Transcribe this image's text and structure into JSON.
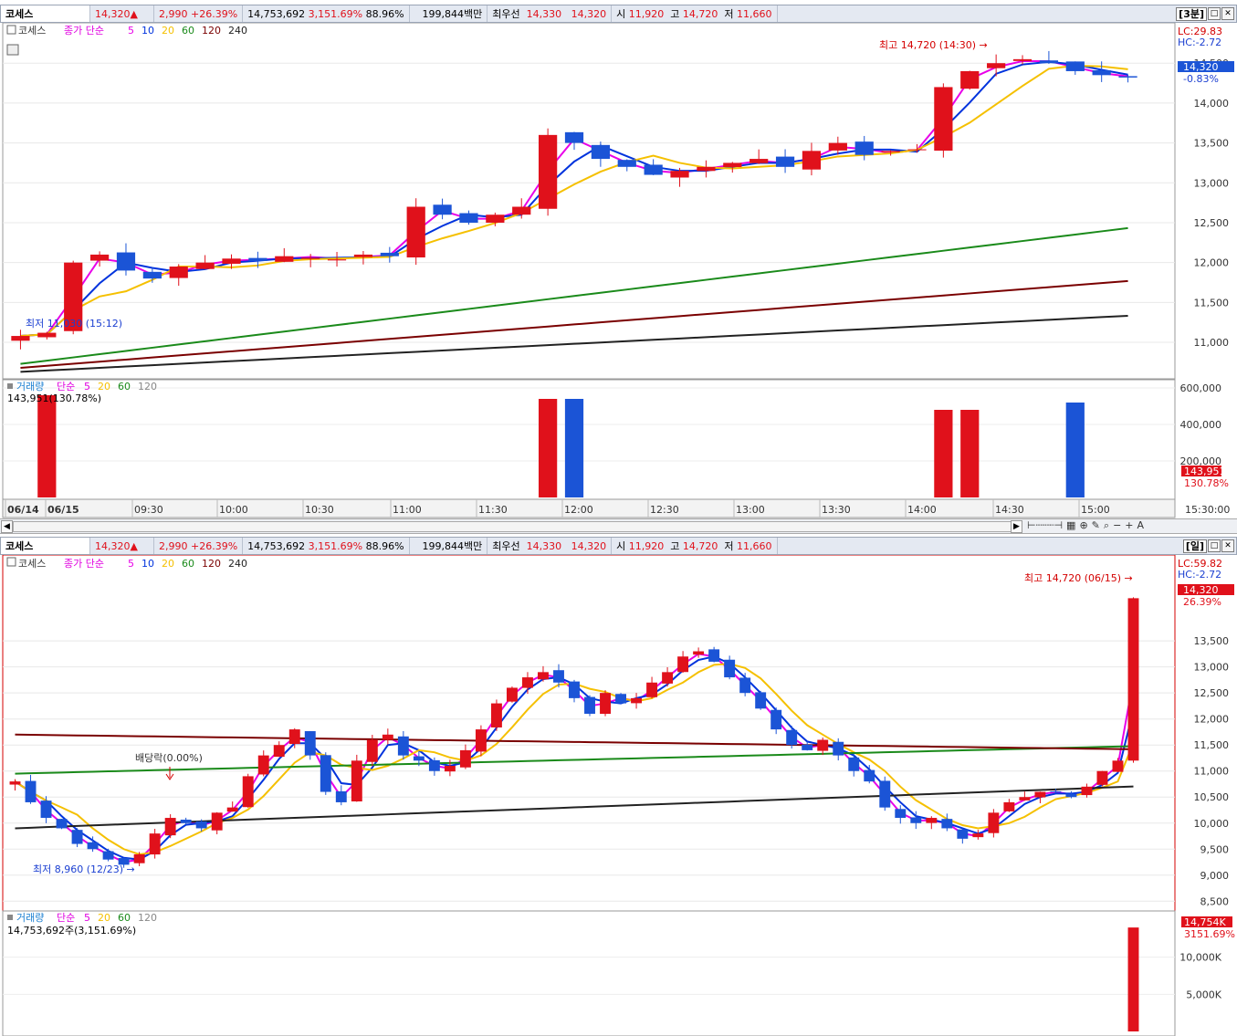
{
  "quote": {
    "name": "코세스",
    "price": "14,320▲",
    "change": "2,990",
    "change_pct": "+26.39%",
    "volume": "14,753,692",
    "volume_pct": "3,151.69%",
    "rate": "88.96%",
    "amount": "199,844백만",
    "best_label": "최우선",
    "ask": "14,330",
    "bid": "14,320",
    "open_label": "시",
    "open": "11,920",
    "high_label": "고",
    "high": "14,720",
    "low_label": "저",
    "low": "11,660"
  },
  "top_panel": {
    "period_button": "3분",
    "legend_name": "코세스",
    "legend_ma_label": "종가 단순",
    "ma_periods": [
      "5",
      "10",
      "20",
      "60",
      "120",
      "240"
    ],
    "ma_colors": [
      "#e800e8",
      "#0033dd",
      "#f5c000",
      "#1a8a1a",
      "#7a0000",
      "#222222"
    ],
    "high_annotation": "최고 14,720 (14:30) →",
    "low_annotation": "최저 11,030 (15:12)",
    "right_top": {
      "lc": "LC:29.83",
      "hc": "HC:-2.72",
      "price": "14,320",
      "pct": "-0.83%"
    },
    "price_axis": [
      "14,500",
      "14,000",
      "13,500",
      "13,000",
      "12,500",
      "12,000",
      "11,500",
      "11,000"
    ],
    "volume_legend": "거래량",
    "volume_legend_ma": "단순",
    "volume_ma_periods": [
      "5",
      "20",
      "60",
      "120"
    ],
    "volume_value": "143,951",
    "volume_value_pct": "(130.78%)",
    "volume_axis": [
      "600,000",
      "400,000",
      "200,000"
    ],
    "volume_box": "143,951",
    "volume_box_pct": "130.78%",
    "time_axis": [
      "06/14",
      "06/15",
      "09:30",
      "10:00",
      "10:30",
      "11:00",
      "11:30",
      "12:00",
      "12:30",
      "13:00",
      "13:30",
      "14:00",
      "14:30",
      "15:00",
      "15:30:00"
    ]
  },
  "bottom_panel": {
    "period_button": "일",
    "legend_name": "코세스",
    "legend_ma_label": "종가 단순",
    "ma_periods": [
      "5",
      "10",
      "20",
      "60",
      "120",
      "240"
    ],
    "high_annotation": "최고 14,720 (06/15) →",
    "low_annotation": "최저 8,960 (12/23) →",
    "dividend_annotation": "배당락(0.00%)",
    "right_top": {
      "lc": "LC:59.82",
      "hc": "HC:-2.72",
      "price": "14,320",
      "pct": "26.39%"
    },
    "price_axis": [
      "13,500",
      "13,000",
      "12,500",
      "12,000",
      "11,500",
      "11,000",
      "10,500",
      "10,000",
      "9,500",
      "9,000",
      "8,500"
    ],
    "volume_legend": "거래량",
    "volume_legend_ma": "단순",
    "volume_ma_periods": [
      "5",
      "20",
      "60",
      "120"
    ],
    "volume_value": "14,753,692주(3,151.69%)",
    "volume_axis": [
      "10,000K",
      "5,000K"
    ],
    "volume_box": "14,754K",
    "volume_box_pct": "3151.69%"
  },
  "chart_data": [
    {
      "type": "candlestick",
      "title": "코세스 3분",
      "ylim": [
        10600,
        14800
      ],
      "ma_lines": [
        "5",
        "10",
        "20",
        "60",
        "120",
        "240"
      ],
      "x_labels": [
        "06/14",
        "06/15",
        "09:30",
        "10:00",
        "10:30",
        "11:00",
        "11:30",
        "12:00",
        "12:30",
        "13:00",
        "13:30",
        "14:00",
        "14:30",
        "15:00"
      ],
      "close_approx": [
        11080,
        11120,
        12000,
        12100,
        11900,
        11800,
        11950,
        12000,
        12050,
        12020,
        12080,
        12060,
        12040,
        12100,
        12080,
        12700,
        12600,
        12500,
        12600,
        12700,
        13600,
        13500,
        13300,
        13200,
        13100,
        13150,
        13200,
        13250,
        13300,
        13200,
        13400,
        13500,
        13350,
        13400,
        13420,
        14200,
        14400,
        14500,
        14550,
        14500,
        14400,
        14350,
        14320
      ],
      "volume_max": 600000
    },
    {
      "type": "candlestick",
      "title": "코세스 일",
      "ylim": [
        8400,
        14800
      ],
      "annotations": [
        "배당락(0.00%)",
        "최저 8,960 (12/23)",
        "최고 14,720 (06/15)"
      ],
      "close_approx": [
        10800,
        10400,
        10100,
        9900,
        9600,
        9500,
        9300,
        9200,
        9400,
        9800,
        10100,
        10000,
        9900,
        10200,
        10300,
        10900,
        11300,
        11500,
        11800,
        11300,
        10600,
        10400,
        11200,
        11600,
        11700,
        11300,
        11200,
        11000,
        11100,
        11400,
        11800,
        12300,
        12600,
        12800,
        12900,
        12700,
        12400,
        12100,
        12500,
        12300,
        12400,
        12700,
        12900,
        13200,
        13300,
        13100,
        12800,
        12500,
        12200,
        11800,
        11500,
        11400,
        11600,
        11300,
        11000,
        10800,
        10300,
        10100,
        10000,
        10100,
        9900,
        9700,
        9800,
        10200,
        10400,
        10500,
        10600,
        10600,
        10500,
        10700,
        11000,
        11200,
        14320
      ],
      "volume_max": 14754
    }
  ]
}
